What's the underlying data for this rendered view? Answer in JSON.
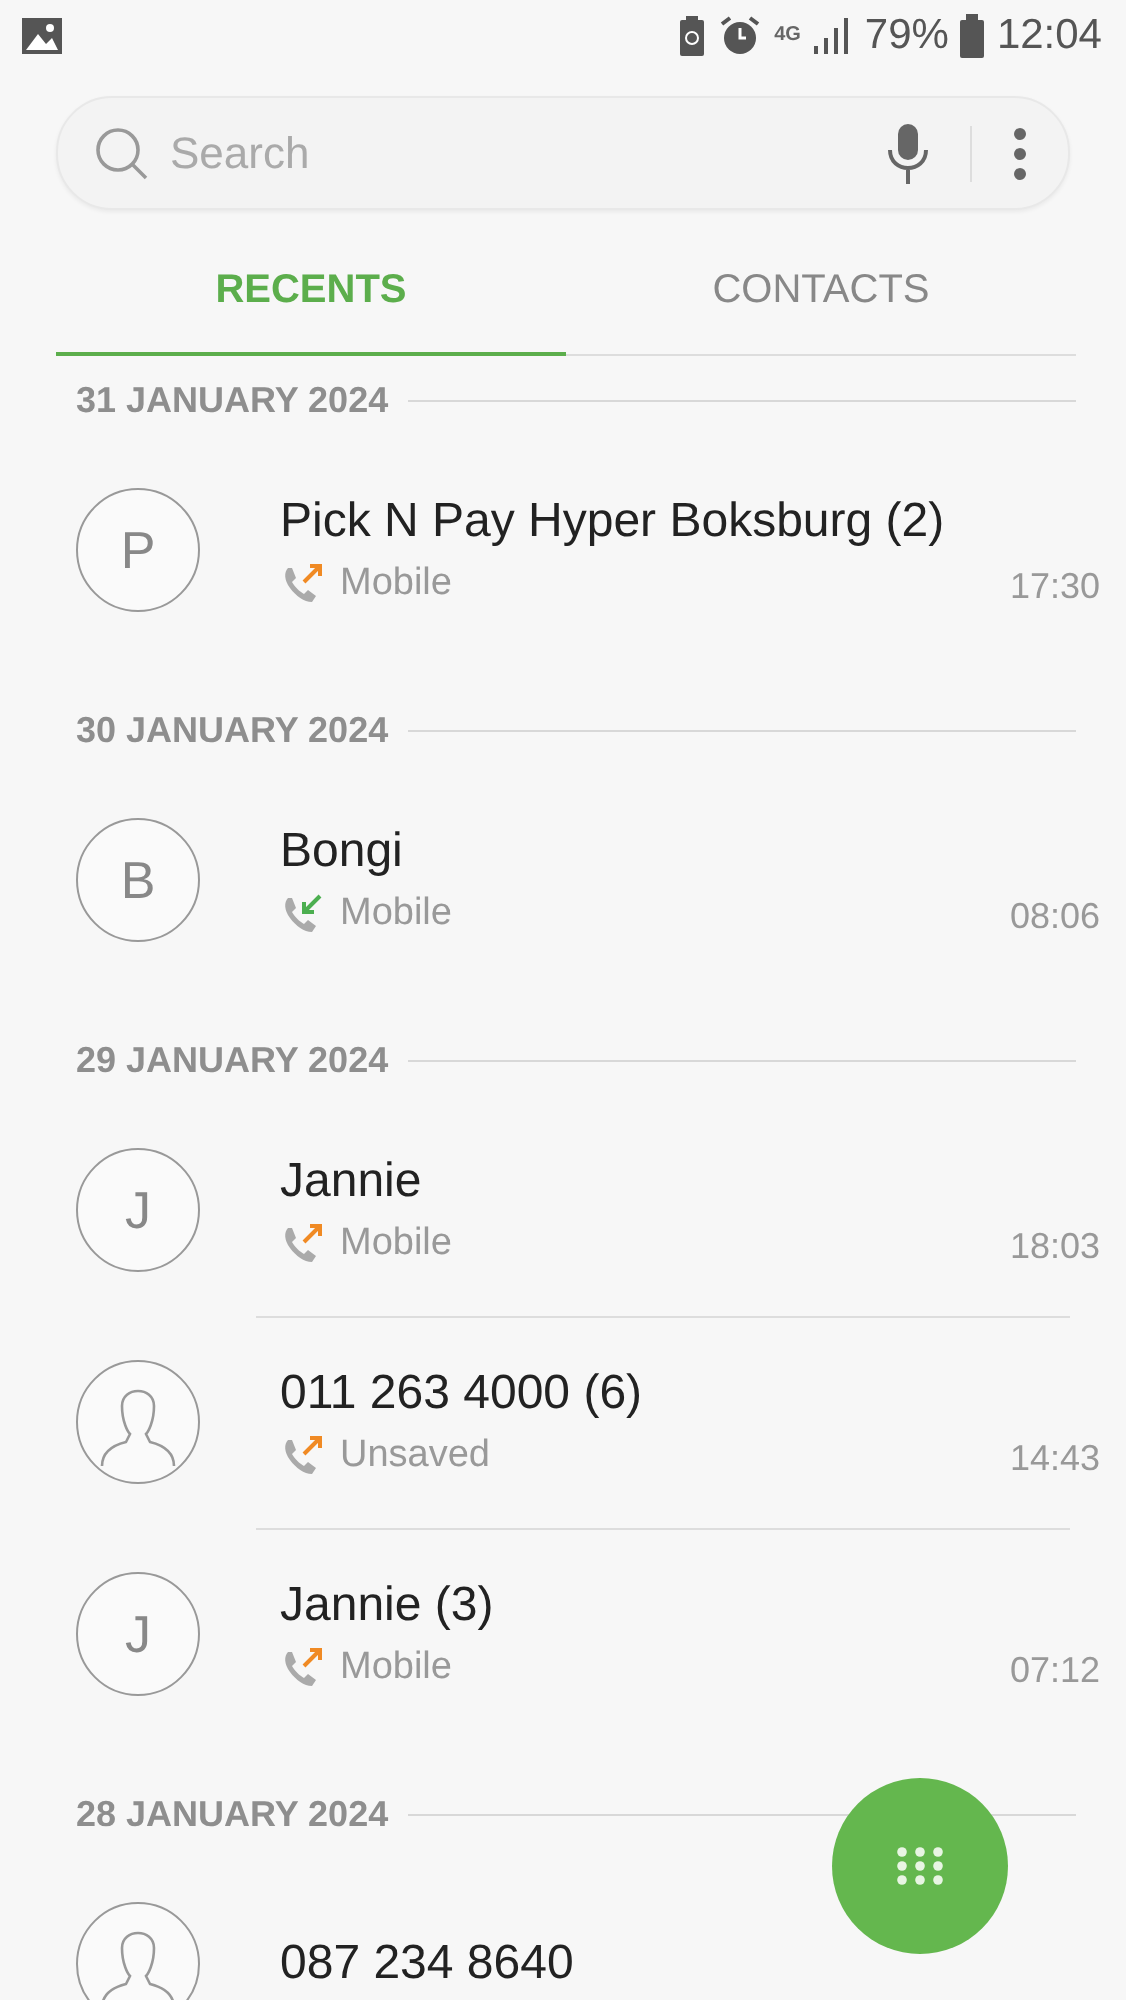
{
  "status_bar": {
    "battery": "79%",
    "time": "12:04",
    "network": "4G"
  },
  "search": {
    "placeholder": "Search"
  },
  "tabs": [
    {
      "label": "RECENTS",
      "selected": true
    },
    {
      "label": "CONTACTS",
      "selected": false
    }
  ],
  "groups": [
    {
      "date": "31 JANUARY 2024",
      "calls": [
        {
          "initial": "P",
          "name": "Pick N Pay Hyper Boksburg (2)",
          "kind": "outgoing",
          "type": "Mobile",
          "time": "17:30"
        }
      ]
    },
    {
      "date": "30 JANUARY 2024",
      "calls": [
        {
          "initial": "B",
          "name": "Bongi",
          "kind": "incoming",
          "type": "Mobile",
          "time": "08:06"
        }
      ]
    },
    {
      "date": "29 JANUARY 2024",
      "calls": [
        {
          "initial": "J",
          "name": "Jannie",
          "kind": "outgoing",
          "type": "Mobile",
          "time": "18:03"
        },
        {
          "name": "011 263 4000 (6)",
          "kind": "outgoing",
          "type": "Unsaved",
          "time": "14:43"
        },
        {
          "initial": "J",
          "name": "Jannie (3)",
          "kind": "outgoing",
          "type": "Mobile",
          "time": "07:12"
        }
      ]
    },
    {
      "date": "28 JANUARY 2024",
      "calls": [
        {
          "name": "087 234 8640"
        }
      ]
    }
  ]
}
